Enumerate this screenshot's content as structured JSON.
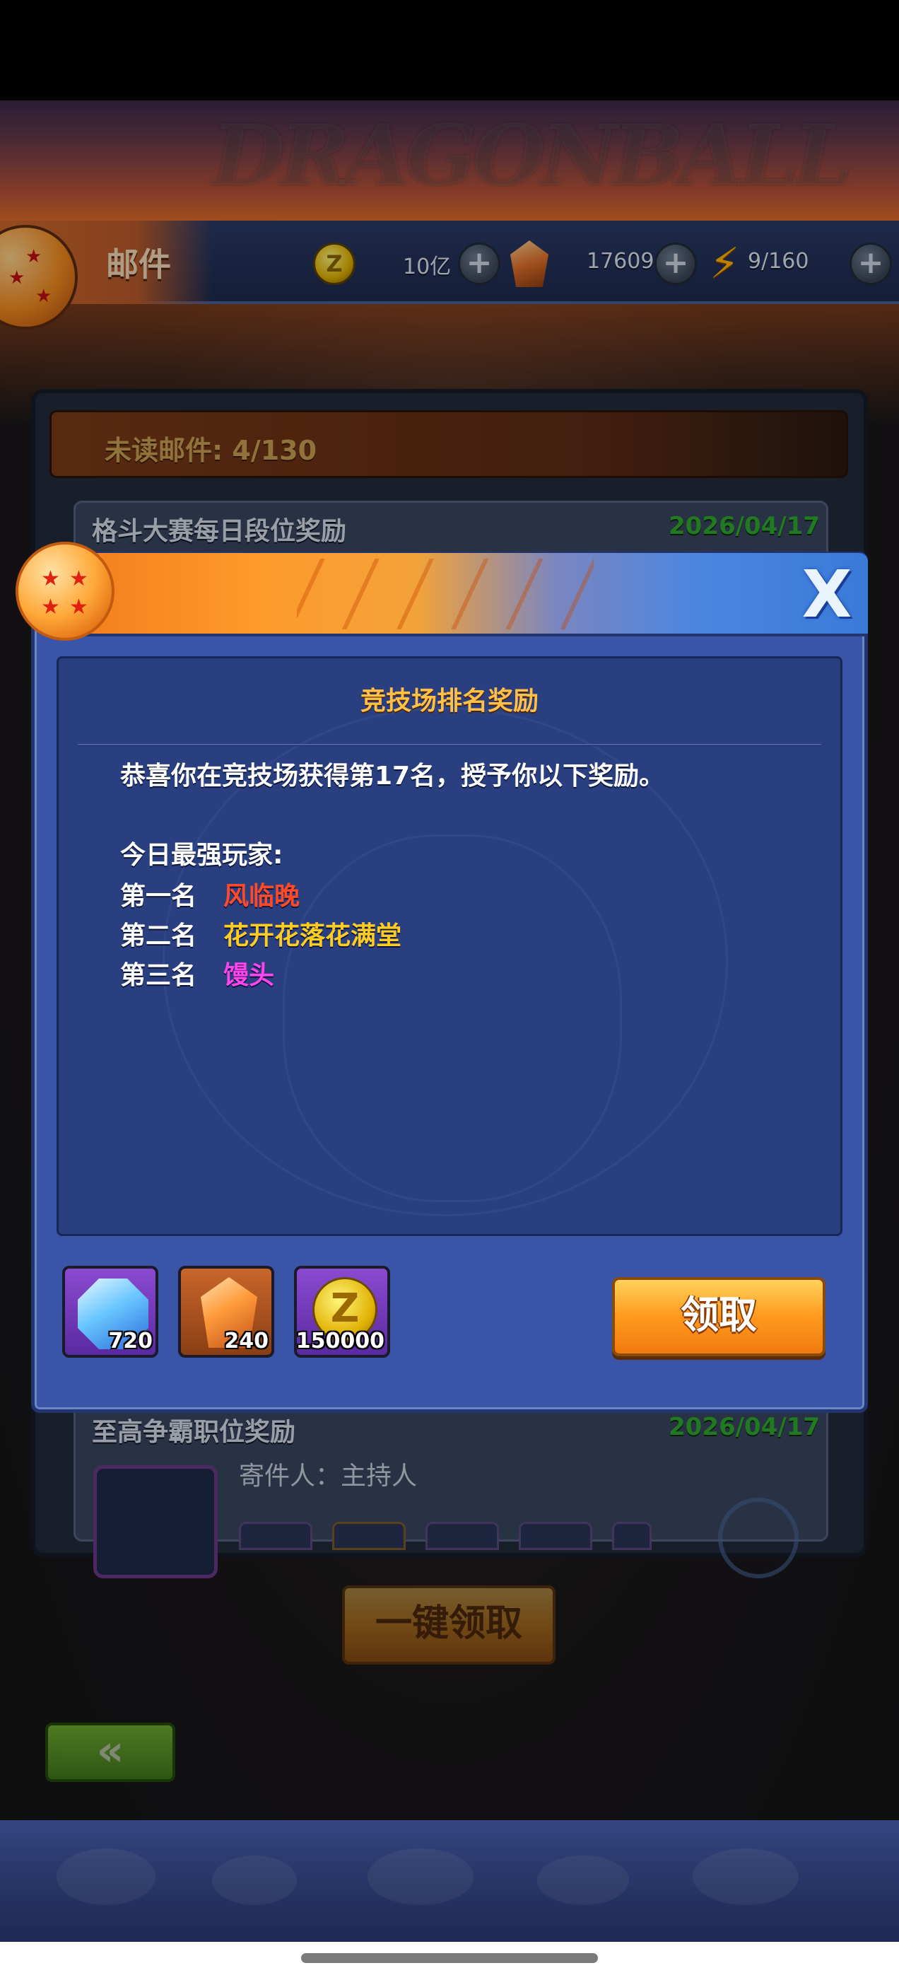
{
  "header": {
    "title": "邮件",
    "zeni_value": "10亿",
    "crystal_value": "17609",
    "stamina_value": "9/160",
    "plus_label": "+",
    "zeni_icon_letter": "Z"
  },
  "mail": {
    "unread_label": "未读邮件: 4/130",
    "items": [
      {
        "title": "格斗大赛每日段位奖励",
        "date": "2026/04/17"
      },
      {
        "title": "至高争霸职位奖励",
        "date": "2026/04/17",
        "sender": "寄件人：主持人"
      }
    ],
    "claim_all_label": "一键领取",
    "back_label": "«"
  },
  "dialog": {
    "close_label": "X",
    "content_title": "竞技场排名奖励",
    "message": "恭喜你在竞技场获得第17名，授予你以下奖励。",
    "strongest_label": "今日最强玩家:",
    "ranks": [
      {
        "label": "第一名",
        "name": "风临晚",
        "color": "#ff4a2a"
      },
      {
        "label": "第二名",
        "name": "花开花落花满堂",
        "color": "#ffcc22"
      },
      {
        "label": "第三名",
        "name": "馒头",
        "color": "#ff44ee"
      }
    ],
    "rewards": [
      {
        "icon": "blue-gem-icon",
        "qty": "720"
      },
      {
        "icon": "orange-crystal-icon",
        "qty": "240"
      },
      {
        "icon": "zeni-coin-icon",
        "qty": "150000",
        "letter": "Z"
      }
    ],
    "claim_label": "领取"
  }
}
